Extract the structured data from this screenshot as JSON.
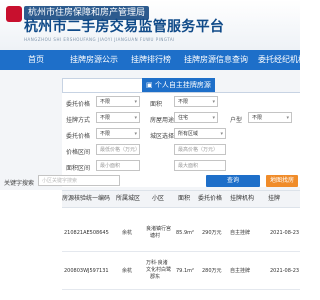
{
  "header": {
    "bureau": "杭州市住房保障和房产管理局",
    "platform_title": "杭州市二手房交易监管服务平台",
    "platform_pinyin": "HANGZHOU SHI ERSHOUFANG JIAOYI JIANGUAN FUWU PINGTAI"
  },
  "nav": {
    "items": [
      "首页",
      "挂牌房源公示",
      "挂牌排行榜",
      "挂牌房源信息查询",
      "委托经纪机构"
    ]
  },
  "panel": {
    "tab_agency": "",
    "tab_personal": "个人自主挂牌房源"
  },
  "filters": {
    "region_label": "委托价格",
    "region_value": "不限",
    "area_label": "面积",
    "area_value": "不限",
    "entrust_label": "挂牌方式",
    "entrust_value": "不限",
    "usage_label": "房屋用途",
    "usage_value": "住宅",
    "layout_label": "户型",
    "layout_value": "不限",
    "price_label": "委托价格",
    "price_value": "不限",
    "district_label": "城区选择",
    "district_value": "所有区域",
    "price_range_label": "价格区间",
    "price_min_placeholder": "最低价格（万元）",
    "price_max_placeholder": "最高价格（万元）",
    "area_range_label": "面积区间",
    "area_min_placeholder": "最小面积",
    "area_max_placeholder": "最大面积",
    "keyword_label": "关键字搜索",
    "keyword_placeholder": "小区关键字搜索",
    "search_button": "查询",
    "map_button": "地图找房"
  },
  "table": {
    "headers": [
      "房源核验统一编码",
      "所属城区",
      "小区",
      "面积",
      "委托价格",
      "挂牌机构",
      "挂牌"
    ],
    "rows": [
      {
        "code": "210821AE508645",
        "district": "余杭",
        "community_1": "良渚镇行宫",
        "community_2": "塘村",
        "area": "85.9m²",
        "price": "290万元",
        "agency": "自主挂牌",
        "date": "2021-08-23"
      },
      {
        "code": "200803WJ597131",
        "district": "余杭",
        "community_1": "万科·良渚",
        "community_2": "文化村白鹭",
        "community_3": "郡东",
        "area": "79.1m²",
        "price": "280万元",
        "agency": "自主挂牌",
        "date": "2021-08-23"
      }
    ]
  }
}
